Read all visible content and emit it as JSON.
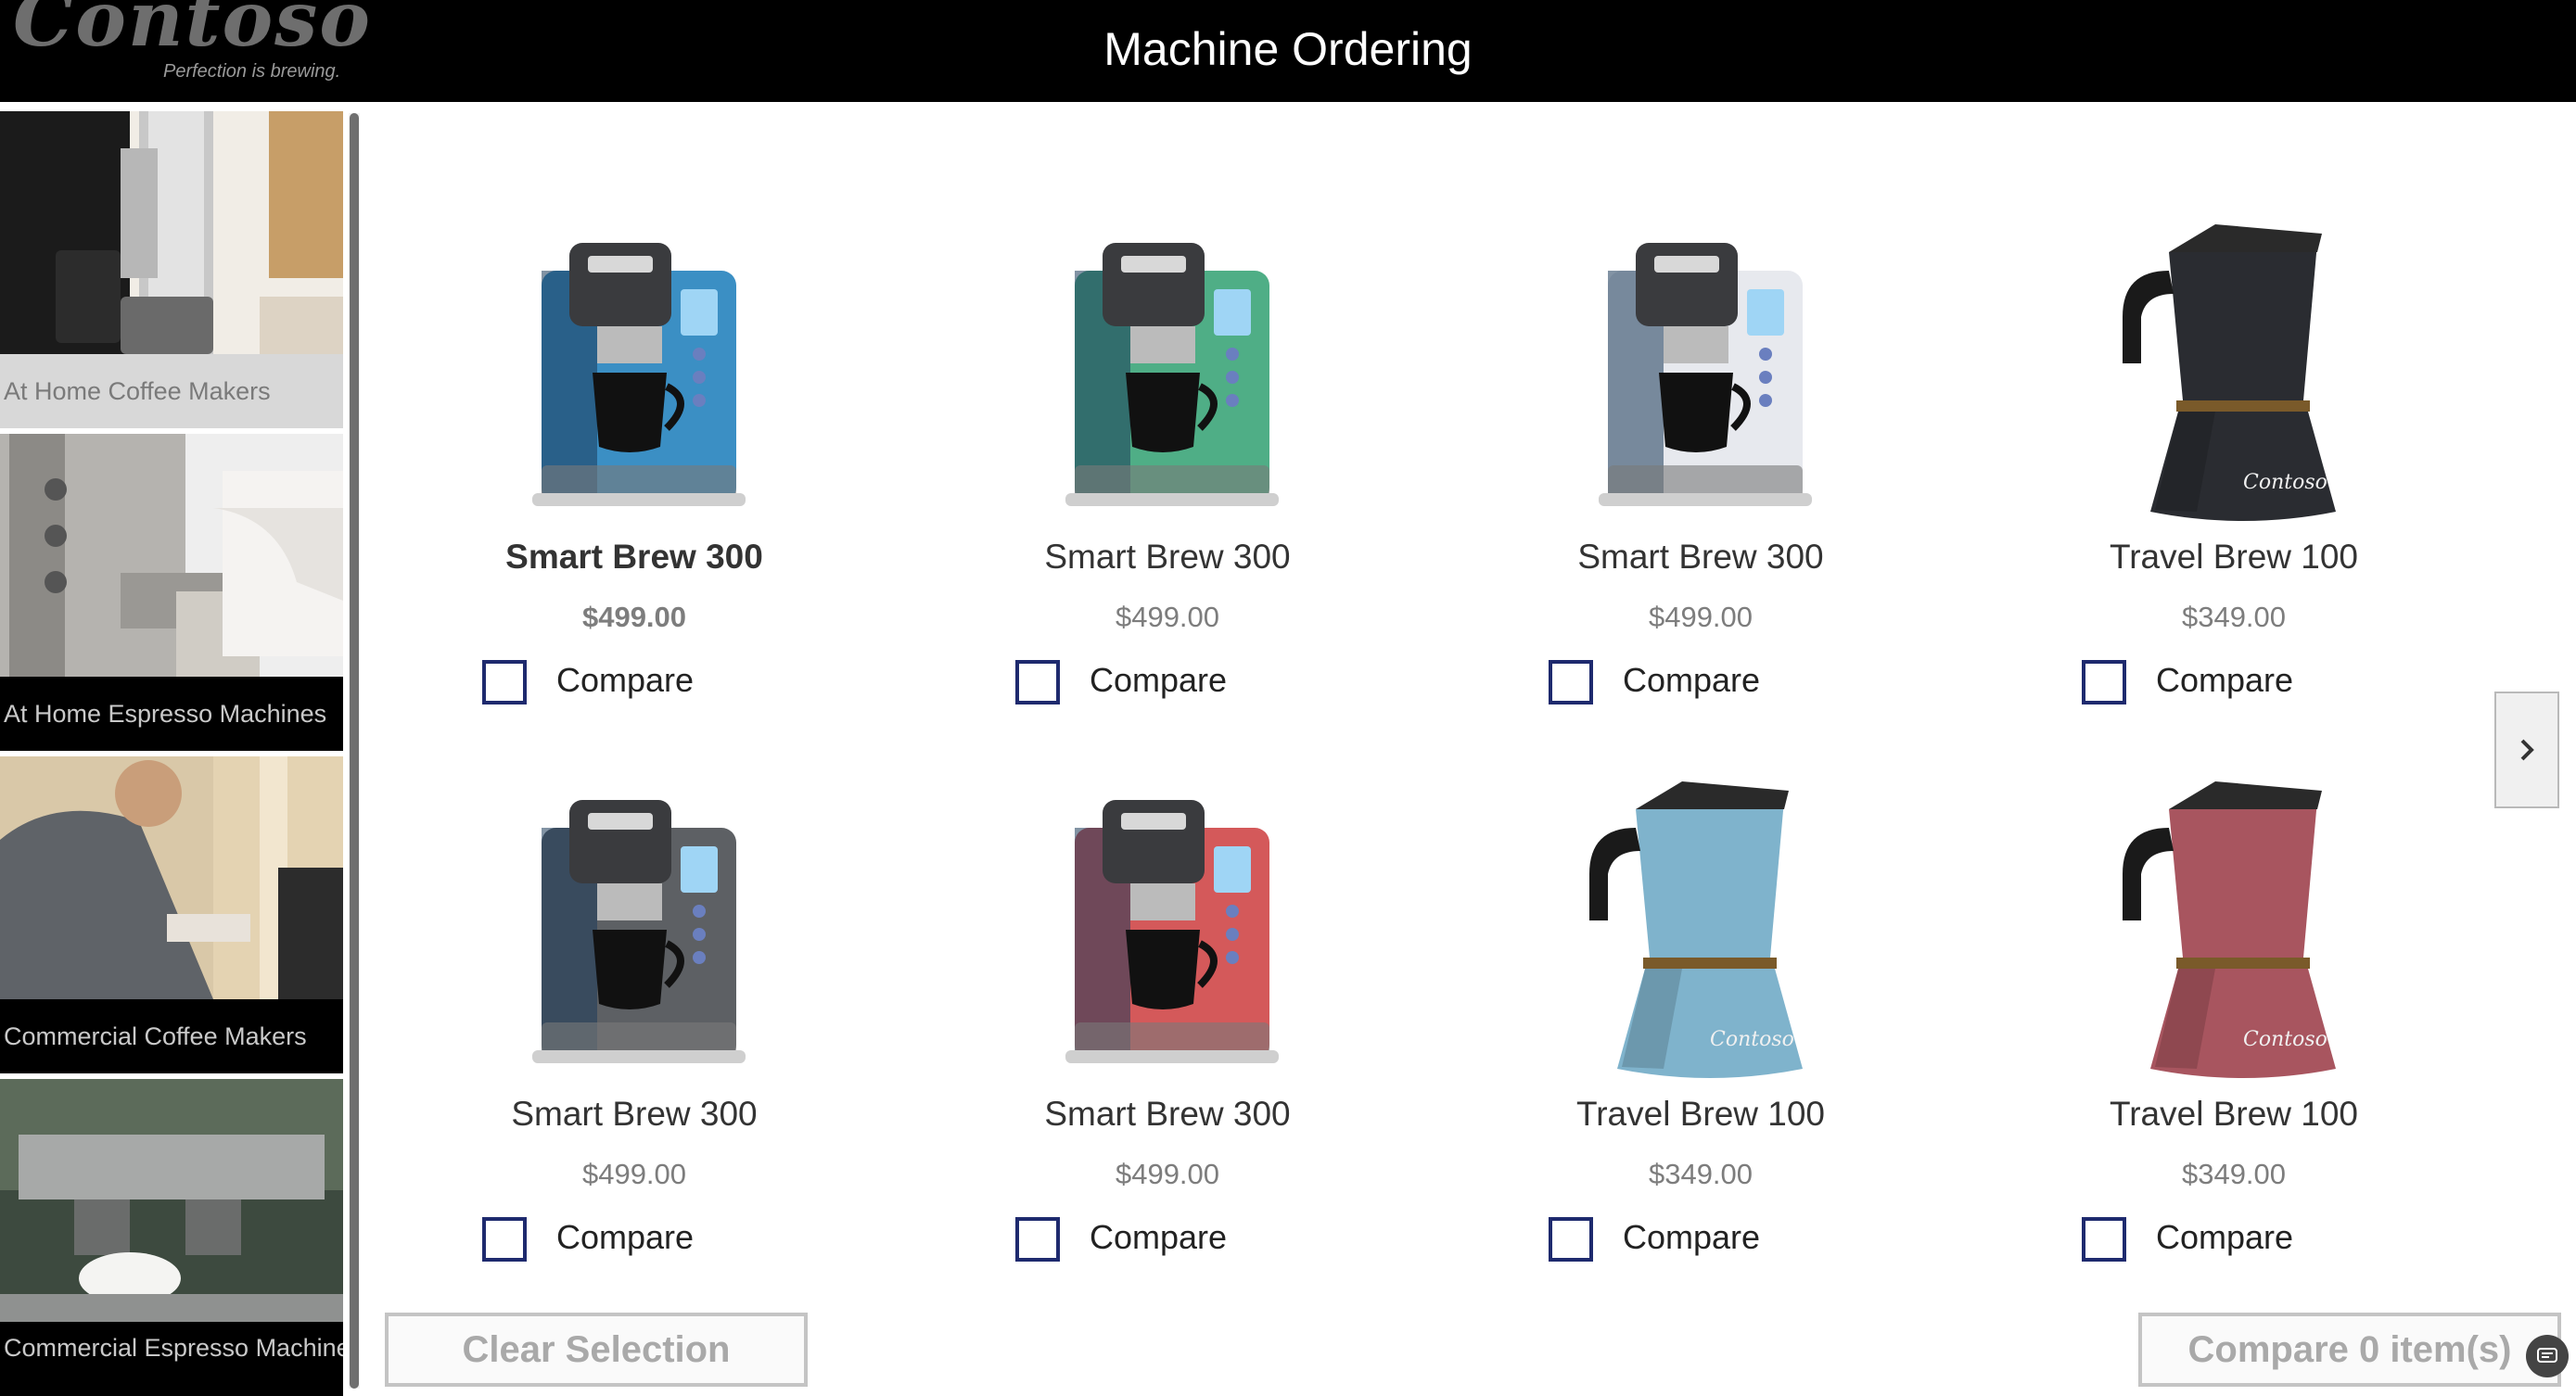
{
  "header": {
    "logo_text": "Contoso",
    "logo_tagline": "Perfection is brewing.",
    "title": "Machine Ordering"
  },
  "sidebar": {
    "categories": [
      {
        "label": "At Home Coffee Makers",
        "selected": true
      },
      {
        "label": "At Home Espresso Machines",
        "selected": false
      },
      {
        "label": "Commercial Coffee Makers",
        "selected": false
      },
      {
        "label": "Commercial Espresso Machines",
        "selected": false
      }
    ]
  },
  "products": [
    {
      "name": "Smart Brew 300",
      "price": "$499.00",
      "compare_label": "Compare",
      "color": "#3b8fc4",
      "kind": "brewer",
      "checked": false
    },
    {
      "name": "Smart Brew 300",
      "price": "$499.00",
      "compare_label": "Compare",
      "color": "#4fae86",
      "kind": "brewer",
      "checked": false
    },
    {
      "name": "Smart Brew 300",
      "price": "$499.00",
      "compare_label": "Compare",
      "color": "#e7e9ee",
      "kind": "brewer",
      "checked": false
    },
    {
      "name": "Travel Brew 100",
      "price": "$349.00",
      "compare_label": "Compare",
      "color": "#2a2c31",
      "kind": "moka",
      "checked": false
    },
    {
      "name": "Smart Brew 300",
      "price": "$499.00",
      "compare_label": "Compare",
      "color": "#5d6064",
      "kind": "brewer",
      "checked": false
    },
    {
      "name": "Smart Brew 300",
      "price": "$499.00",
      "compare_label": "Compare",
      "color": "#d4595a",
      "kind": "brewer",
      "checked": false
    },
    {
      "name": "Travel Brew 100",
      "price": "$349.00",
      "compare_label": "Compare",
      "color": "#7fb3cc",
      "kind": "moka",
      "checked": false
    },
    {
      "name": "Travel Brew 100",
      "price": "$349.00",
      "compare_label": "Compare",
      "color": "#a8555f",
      "kind": "moka",
      "checked": false
    }
  ],
  "footer": {
    "clear_label": "Clear Selection",
    "compare_label": "Compare 0 item(s)"
  }
}
